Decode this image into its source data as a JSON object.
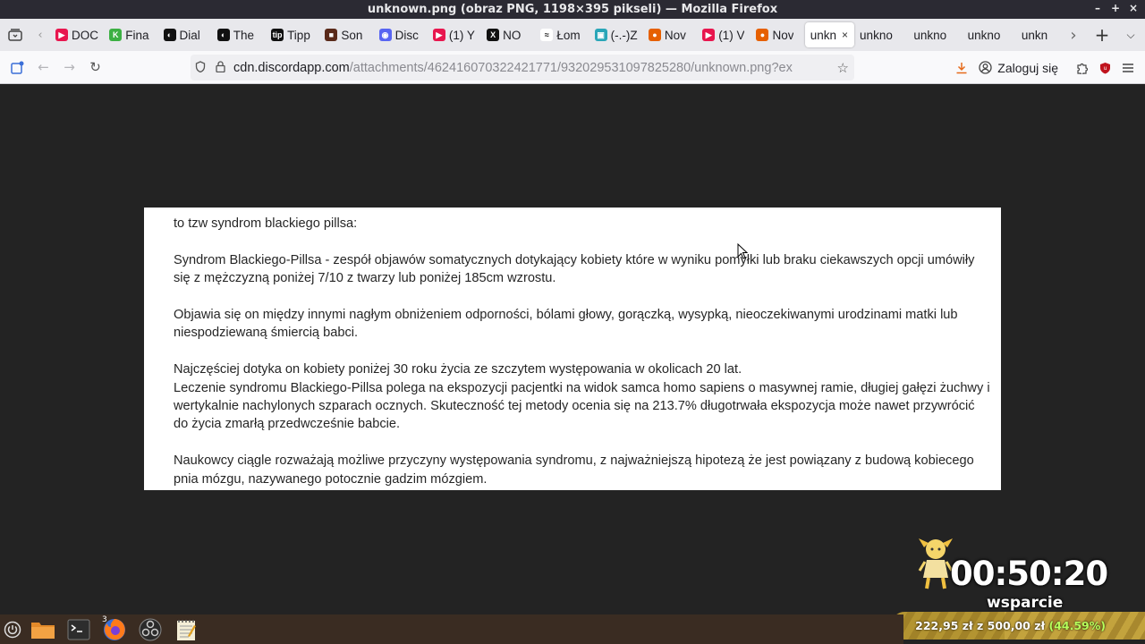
{
  "window": {
    "title": "unknown.png (obraz PNG, 1198×395 pikseli) — Mozilla Firefox",
    "controls": [
      "–",
      "+",
      "×"
    ]
  },
  "tabs": [
    {
      "label": "DOC",
      "color": "#e8164e",
      "glyph": "▶"
    },
    {
      "label": "Fina",
      "color": "#3cb043",
      "glyph": "K"
    },
    {
      "label": "Dial",
      "color": "#111111",
      "glyph": "◐"
    },
    {
      "label": "The",
      "color": "#111111",
      "glyph": "◐"
    },
    {
      "label": "Tipp",
      "color": "#111111",
      "glyph": "tip"
    },
    {
      "label": "Son",
      "color": "#5a2a1a",
      "glyph": "■"
    },
    {
      "label": "Disc",
      "color": "#5865f2",
      "glyph": "◉"
    },
    {
      "label": "(1) Y",
      "color": "#e8164e",
      "glyph": "▶"
    },
    {
      "label": "NO",
      "color": "#111111",
      "glyph": "X"
    },
    {
      "label": "Łom",
      "color": "#ffffff",
      "glyph": "≈"
    },
    {
      "label": "(-.-)Z",
      "color": "#2aa6b8",
      "glyph": "▣"
    },
    {
      "label": "Nov",
      "color": "#e66000",
      "glyph": "●"
    },
    {
      "label": "(1) V",
      "color": "#e8164e",
      "glyph": "▶"
    },
    {
      "label": "Nov",
      "color": "#e66000",
      "glyph": "●"
    },
    {
      "label": "unkn",
      "active": true
    },
    {
      "label": "unkno"
    },
    {
      "label": "unkno"
    },
    {
      "label": "unkno"
    },
    {
      "label": "unkn"
    }
  ],
  "tab_close": "×",
  "url": {
    "domain": "cdn.discordapp.com",
    "path": "/attachments/462416070322421771/932029531097825280/unknown.png?ex"
  },
  "nav": {
    "login_label": "Zaloguj się"
  },
  "document": {
    "paragraphs": [
      "to tzw syndrom blackiego pillsa:",
      "Syndrom Blackiego-Pillsa - zespół objawów somatycznych dotykający kobiety które w wyniku pomyłki lub braku ciekawszych opcji umówiły się z mężczyzną poniżej 7/10 z twarzy lub poniżej 185cm wzrostu.",
      "Objawia się on między innymi nagłym obniżeniem odporności, bólami głowy, gorączką, wysypką, nieoczekiwanymi urodzinami matki lub niespodziewaną śmiercią babci.",
      "Najczęściej dotyka on kobiety poniżej 30 roku życia ze szczytem występowania w okolicach 20 lat.",
      "Leczenie syndromu Blackiego-Pillsa polega na ekspozycji pacjentki na widok samca homo sapiens o masywnej ramie, długiej gałęzi żuchwy i wertykalnie nachylonych szparach ocznych. Skuteczność tej metody ocenia się na 213.7% długotrwała ekspozycja może nawet przywrócić do życia zmarłą przedwcześnie babcie.",
      "Naukowcy ciągle rozważają możliwe przyczyny występowania syndromu, z najważniejszą hipotezą że jest powiązany z budową kobiecego pnia mózgu, nazywanego potocznie gadzim mózgiem."
    ]
  },
  "overlay": {
    "timer": "00:50:20",
    "support_label": "wsparcie",
    "donation_current": "222,95 zł",
    "donation_sep": " z ",
    "donation_goal": "500,00 zł",
    "donation_pct_text": "(44.59%)",
    "donation_fraction": 0.4459
  },
  "taskbar": {
    "firefox_badge": "3"
  }
}
